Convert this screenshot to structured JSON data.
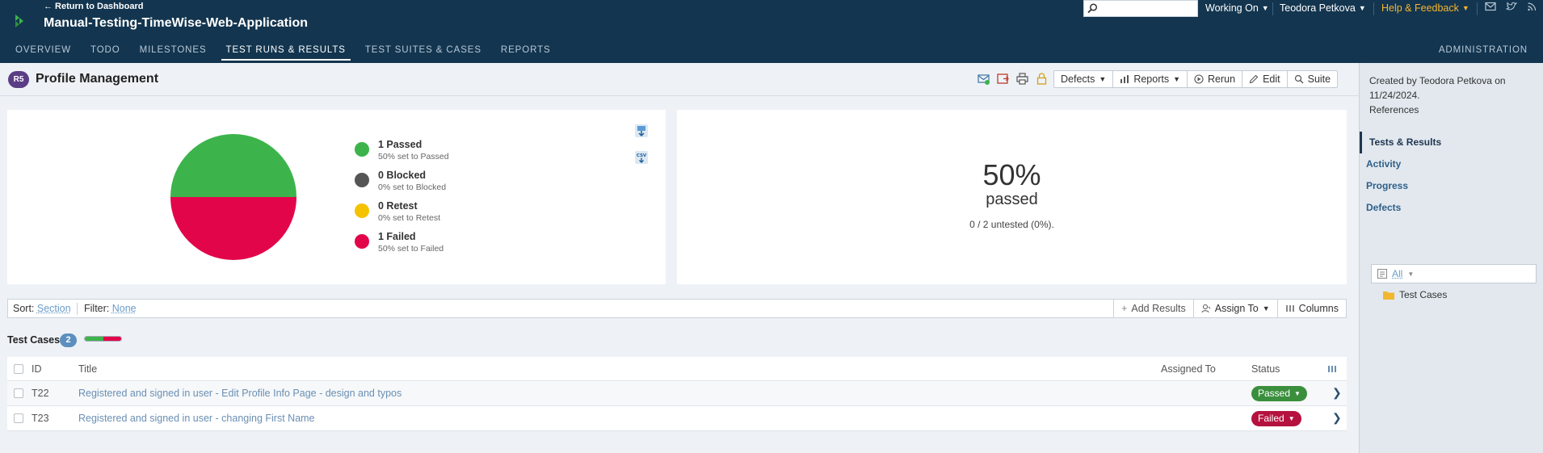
{
  "header": {
    "return_link": "← Return to Dashboard",
    "project_title": "Manual-Testing-TimeWise-Web-Application",
    "search_placeholder": "",
    "working_on": "Working On",
    "user": "Teodora Petkova",
    "help": "Help & Feedback"
  },
  "nav": {
    "items": [
      "OVERVIEW",
      "TODO",
      "MILESTONES",
      "TEST RUNS & RESULTS",
      "TEST SUITES & CASES",
      "REPORTS"
    ],
    "active": "TEST RUNS & RESULTS",
    "admin": "ADMINISTRATION"
  },
  "run": {
    "badge": "R5",
    "title": "Profile Management",
    "buttons": {
      "defects": "Defects",
      "reports": "Reports",
      "rerun": "Rerun",
      "edit": "Edit",
      "suite": "Suite"
    }
  },
  "stats": {
    "legend": [
      {
        "label": "1 Passed",
        "sub": "50% set to Passed",
        "color": "#3cb44b"
      },
      {
        "label": "0 Blocked",
        "sub": "0% set to Blocked",
        "color": "#555555"
      },
      {
        "label": "0 Retest",
        "sub": "0% set to Retest",
        "color": "#f5c200"
      },
      {
        "label": "1 Failed",
        "sub": "50% set to Failed",
        "color": "#e3054a"
      }
    ],
    "pie": {
      "passed": 50,
      "failed": 50
    },
    "percent": "50%",
    "percent_word": "passed",
    "untested": "0 / 2 untested (0%)."
  },
  "sidebar": {
    "created_line1": "Created by Teodora Petkova on",
    "created_line2": "11/24/2024.",
    "references": "References",
    "links": [
      "Tests & Results",
      "Activity",
      "Progress",
      "Defects"
    ],
    "tree_filter": "All",
    "tree_item": "Test Cases"
  },
  "sortbar": {
    "sort_label": "Sort:",
    "sort_value": "Section",
    "filter_label": "Filter:",
    "filter_value": "None",
    "add_results": "Add Results",
    "assign_to": "Assign To",
    "columns": "Columns"
  },
  "tests": {
    "section_title": "Test Cases",
    "count": "2",
    "progress": {
      "passed": 50,
      "failed": 50
    },
    "columns": {
      "id": "ID",
      "title": "Title",
      "assigned": "Assigned To",
      "status": "Status"
    },
    "rows": [
      {
        "id": "T22",
        "title": "Registered and signed in user - Edit Profile Info Page - design and typos",
        "status": "Passed",
        "color": "#3a8f3d"
      },
      {
        "id": "T23",
        "title": "Registered and signed in user - changing First Name",
        "status": "Failed",
        "color": "#b5123f"
      }
    ]
  }
}
